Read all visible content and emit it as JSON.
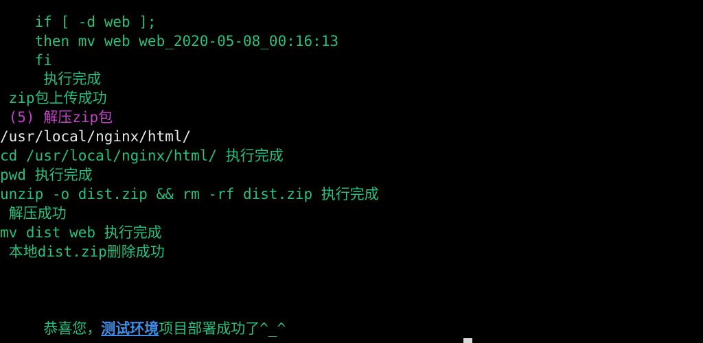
{
  "terminal": {
    "lines": [
      {
        "text": "    if [ -d web ];",
        "color": "green"
      },
      {
        "text": "    then mv web web_2020-05-08_00:16:13",
        "color": "green"
      },
      {
        "text": "    fi",
        "color": "green"
      },
      {
        "text": "     执行完成",
        "color": "green"
      },
      {
        "text": " zip包上传成功",
        "color": "green"
      },
      {
        "text": " (5) 解压zip包",
        "color": "magenta"
      },
      {
        "text": "/usr/local/nginx/html/",
        "color": "white"
      },
      {
        "text": "cd /usr/local/nginx/html/ 执行完成",
        "color": "green"
      },
      {
        "text": "pwd 执行完成",
        "color": "green"
      },
      {
        "text": "unzip -o dist.zip && rm -rf dist.zip 执行完成",
        "color": "green"
      },
      {
        "text": " 解压成功",
        "color": "green"
      },
      {
        "text": "mv dist web 执行完成",
        "color": "green"
      },
      {
        "text": " 本地dist.zip删除成功",
        "color": "green"
      }
    ],
    "final": {
      "prefix": " 恭喜您，",
      "highlight": "测试环境",
      "suffix": "项目部署成功了^_^"
    }
  },
  "colors": {
    "background": "#000000",
    "green": "#27c07d",
    "magenta": "#c243c9",
    "white": "#e8e8e8",
    "blue": "#3f8ee6"
  }
}
